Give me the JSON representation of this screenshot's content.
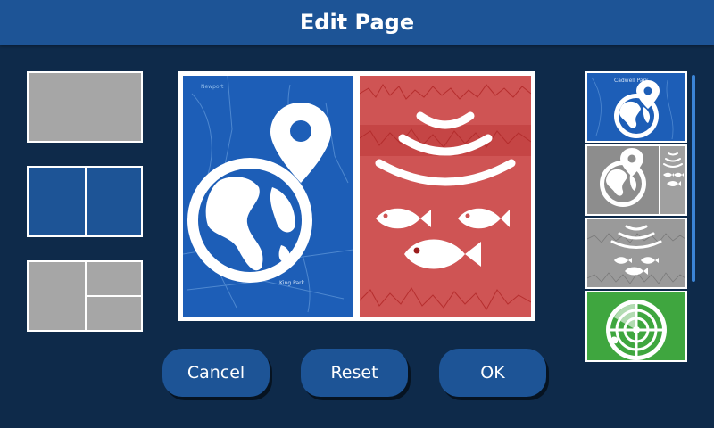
{
  "header": {
    "title": "Edit Page"
  },
  "layouts": [
    {
      "name": "single-pane"
    },
    {
      "name": "two-pane-split"
    },
    {
      "name": "three-pane-split"
    }
  ],
  "preview": {
    "left_pane": {
      "icon": "chart-globe-icon",
      "map_label": "King Park"
    },
    "right_pane": {
      "icon": "sonar-fish-icon"
    }
  },
  "buttons": {
    "cancel": "Cancel",
    "reset": "Reset",
    "ok": "OK"
  },
  "thumbnails": [
    {
      "name": "chart-app",
      "icon": "chart-globe-icon",
      "map_label": "Cadwell Park"
    },
    {
      "name": "chart-sonar-combo",
      "icon": "chart-sonar-combo-icon"
    },
    {
      "name": "sonar-app",
      "icon": "sonar-fish-icon"
    },
    {
      "name": "radar-app",
      "icon": "radar-icon"
    }
  ],
  "colors": {
    "background": "#0e2a4a",
    "titlebar": "#1d5496",
    "button": "#1d5496",
    "chart_blue": "#1d5eb7",
    "sonar_red": "#cf5454",
    "radar_green": "#3fa63f",
    "inactive_gray": "#a6a6a6"
  }
}
